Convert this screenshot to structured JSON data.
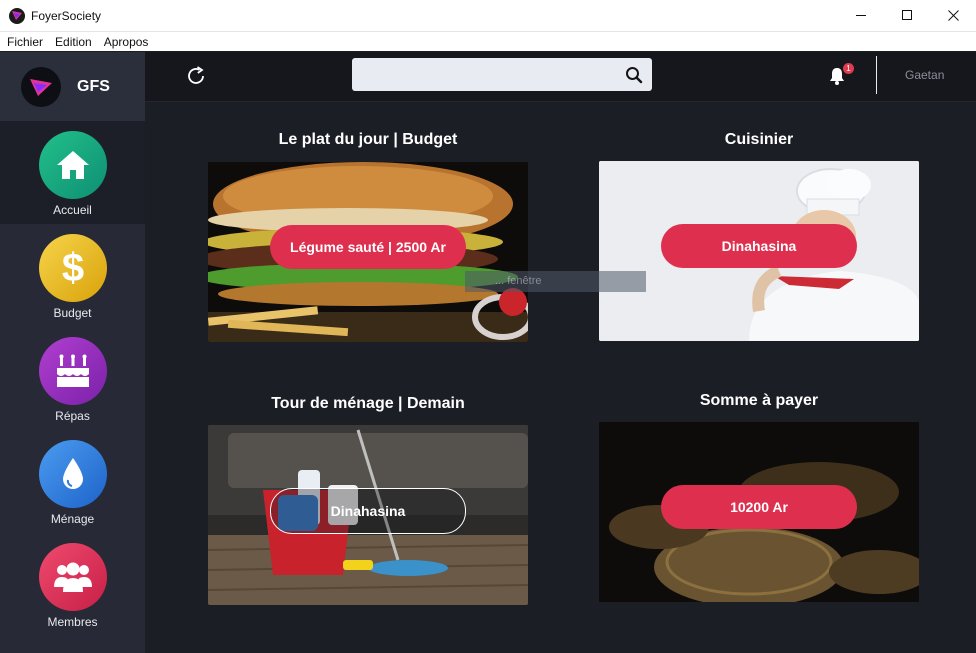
{
  "window": {
    "title": "FoyerSociety",
    "controls": [
      "minimize",
      "maximize",
      "close"
    ]
  },
  "menu": [
    "Fichier",
    "Edition",
    "Apropos"
  ],
  "sidebar": {
    "brand": "GFS",
    "items": [
      {
        "label": "Accueil",
        "icon": "home-icon",
        "color": "#12a87c",
        "active": true
      },
      {
        "label": "Budget",
        "icon": "dollar-icon",
        "color": "#f0c31b",
        "active": false
      },
      {
        "label": "Répas",
        "icon": "cake-icon",
        "color": "#9d2fc2",
        "active": false
      },
      {
        "label": "Ménage",
        "icon": "drop-icon",
        "color": "#2e7fe2",
        "active": false
      },
      {
        "label": "Membres",
        "icon": "users-icon",
        "color": "#e3335b",
        "active": false
      }
    ]
  },
  "topbar": {
    "search_placeholder": "",
    "notifications_count": "1",
    "user_name": "Gaetan"
  },
  "cards": [
    {
      "title": "Le plat du jour | Budget",
      "button": "Légume sauté | 2500 Ar"
    },
    {
      "title": "Cuisinier",
      "button": "Dinahasina"
    },
    {
      "title": "Tour de ménage | Demain",
      "button": "Dinahasina"
    },
    {
      "title": "Somme à payer",
      "button": "10200 Ar"
    }
  ],
  "tooltip": "... fenêtre"
}
